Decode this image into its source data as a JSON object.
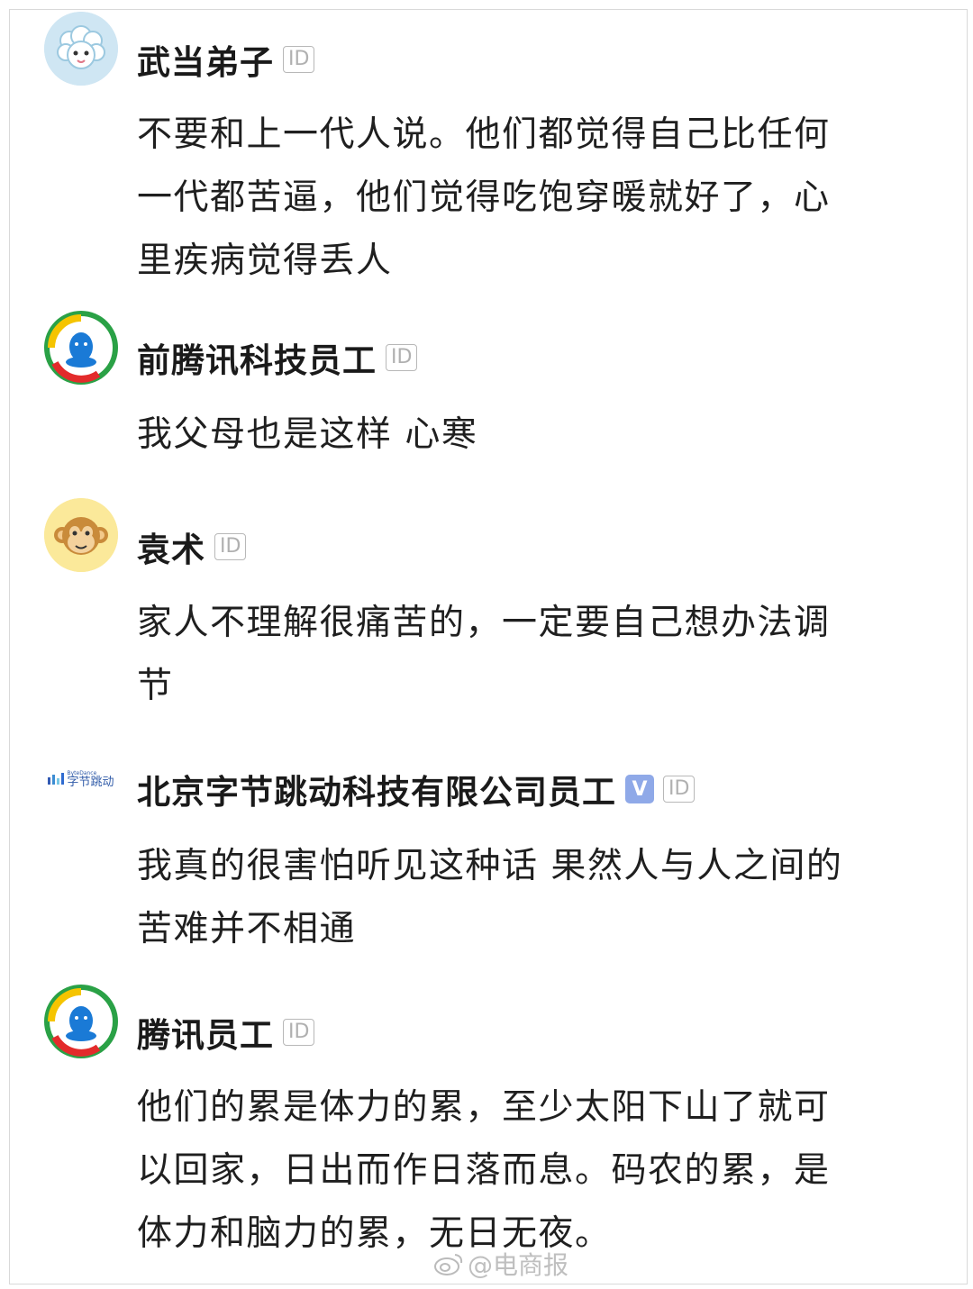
{
  "comments": [
    {
      "name": "武当弟子",
      "id_badge": "ID",
      "text_lines": [
        "不要和上一代人说。他们都觉得自己比任何",
        "一代都苦逼，他们觉得吃饱穿暖就好了，心",
        "里疾病觉得丢人"
      ],
      "avatar_icon": "sheep-avatar-icon"
    },
    {
      "name": "前腾讯科技员工",
      "id_badge": "ID",
      "text_lines": [
        "我父母也是这样 心寒"
      ],
      "avatar_icon": "tencent-logo-icon"
    },
    {
      "name": "袁术",
      "id_badge": "ID",
      "text_lines": [
        "家人不理解很痛苦的，一定要自己想办法调",
        "节"
      ],
      "avatar_icon": "monkey-avatar-icon"
    },
    {
      "name": "北京字节跳动科技有限公司员工",
      "id_badge": "ID",
      "verified_badge": "V",
      "text_lines": [
        "我真的很害怕听见这种话 果然人与人之间的",
        "苦难并不相通"
      ],
      "avatar_icon": "bytedance-logo-icon",
      "avatar_logo_text": "字节跳动",
      "avatar_logo_small": "ByteDance"
    },
    {
      "name": "腾讯员工",
      "id_badge": "ID",
      "text_lines": [
        "他们的累是体力的累，至少太阳下山了就可",
        "以回家，日出而作日落而息。码农的累，是",
        "体力和脑力的累，无日无夜。"
      ],
      "avatar_icon": "tencent-logo-icon"
    }
  ],
  "watermark": {
    "text": "@电商报",
    "icon": "weibo-icon"
  },
  "colors": {
    "text": "#1f1f1f",
    "badge_border": "#b8b8b8",
    "verified": "#8fa9e8"
  }
}
